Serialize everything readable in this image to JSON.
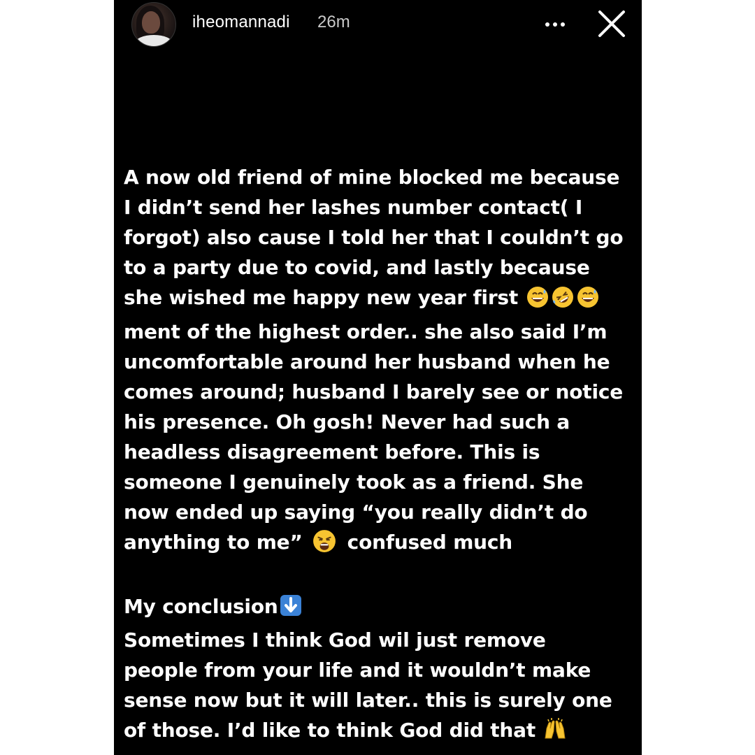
{
  "story": {
    "header": {
      "username": "iheomannadi",
      "time": "26m"
    },
    "icons": {
      "avatar": "profile-photo",
      "more": "more-horizontal-icon",
      "close": "close-icon"
    },
    "text": {
      "p1_l1": "A now old friend of mine blocked me because",
      "p1_l2": "I didn’t send her lashes number contact( I",
      "p1_l3": "forgot) also cause I told her that I couldn’t go",
      "p1_l4": "to a party due to covid, and lastly because",
      "p1_l5": "she wished me happy new year first",
      "p1_l6": "ment of the highest order.. she also said I’m",
      "p1_l7": "uncomfortable around her husband when he",
      "p1_l8": "comes around; husband I barely see or notice",
      "p1_l9": "his presence. Oh gosh! Never had such a",
      "p1_l10": "headless disagreement before. This is",
      "p1_l11": "someone I genuinely took as a friend. She",
      "p1_l12": "now ended up saying “you really didn’t do",
      "p1_l13a": "anything to me”",
      "p1_l13b": "confused much",
      "p2_l1": "My conclusion",
      "p2_l2": "Sometimes I think God wil just remove",
      "p2_l3": "people from your life and it wouldn’t make",
      "p2_l4": "sense now but it will later.. this is surely one",
      "p2_l5": "of those. I’d like to think God did that"
    },
    "emoji_names": {
      "grin_sweat": "grinning-face-with-sweat-emoji",
      "rofl": "rolling-on-the-floor-laughing-emoji",
      "weary": "weary-face-emoji",
      "down_arrow": "down-arrow-emoji",
      "raised_hands": "raising-hands-emoji"
    },
    "colors": {
      "background": "#000000",
      "text": "#ffffff",
      "time": "#c9c9c9",
      "emoji_yellow": "#f7c431",
      "arrow_blue": "#3b82d6"
    }
  }
}
